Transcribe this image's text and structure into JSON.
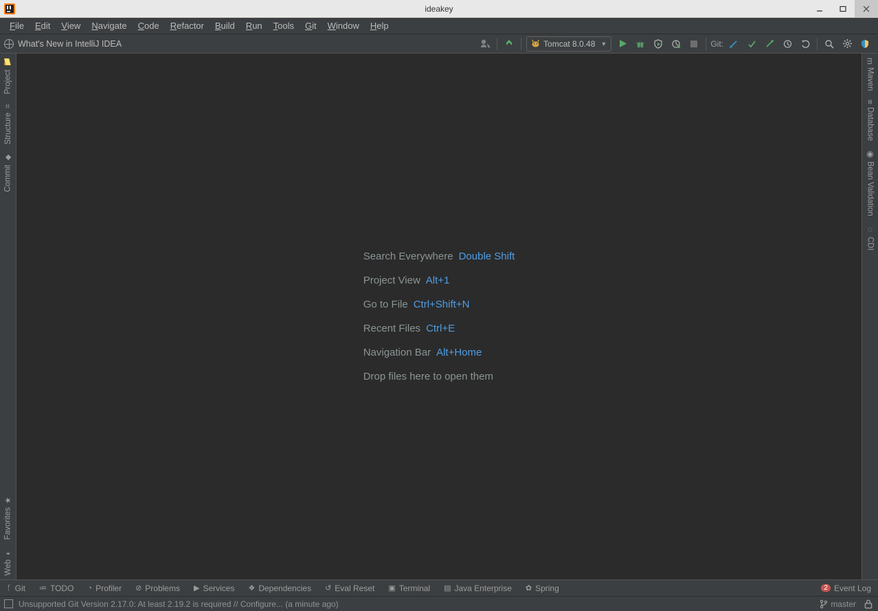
{
  "title": "ideakey",
  "menu": [
    "File",
    "Edit",
    "View",
    "Navigate",
    "Code",
    "Refactor",
    "Build",
    "Run",
    "Tools",
    "Git",
    "Window",
    "Help"
  ],
  "nav_label": "What's New in IntelliJ IDEA",
  "run_config": "Tomcat 8.0.48",
  "git_label": "Git:",
  "left_tools": {
    "top": [
      "Project",
      "Structure",
      "Commit"
    ],
    "bottom": [
      "Favorites",
      "Web"
    ]
  },
  "right_tools": [
    "Maven",
    "Database",
    "Bean Validation",
    "CDI"
  ],
  "hints": [
    {
      "label": "Search Everywhere",
      "shortcut": "Double Shift"
    },
    {
      "label": "Project View",
      "shortcut": "Alt+1"
    },
    {
      "label": "Go to File",
      "shortcut": "Ctrl+Shift+N"
    },
    {
      "label": "Recent Files",
      "shortcut": "Ctrl+E"
    },
    {
      "label": "Navigation Bar",
      "shortcut": "Alt+Home"
    }
  ],
  "drop_hint": "Drop files here to open them",
  "bottom_tools": [
    "Git",
    "TODO",
    "Profiler",
    "Problems",
    "Services",
    "Dependencies",
    "Eval Reset",
    "Terminal",
    "Java Enterprise",
    "Spring"
  ],
  "event_log": {
    "count": "2",
    "label": "Event Log"
  },
  "status_msg": "Unsupported Git Version 2.17.0: At least 2.19.2 is required // Configure... (a minute ago)",
  "branch": "master"
}
